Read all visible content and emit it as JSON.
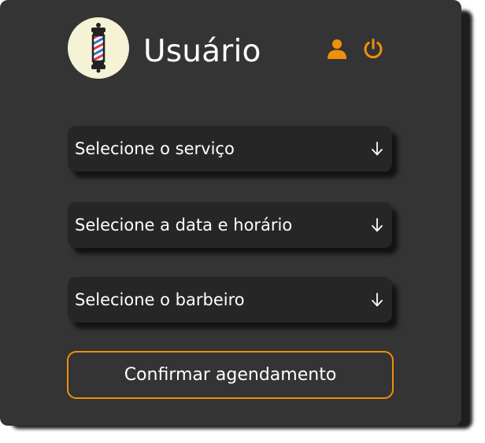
{
  "header": {
    "title": "Usuário",
    "logo_icon": "barber-pole-icon",
    "user_icon": "user-icon",
    "power_icon": "power-icon"
  },
  "selects": [
    {
      "label": "Selecione o serviço",
      "icon": "arrow-down-icon"
    },
    {
      "label": "Selecione a data e horário",
      "icon": "arrow-down-icon"
    },
    {
      "label": "Selecione o barbeiro",
      "icon": "arrow-down-icon"
    }
  ],
  "confirm_button": {
    "label": "Confirmar agendamento"
  },
  "colors": {
    "card_background": "#343434",
    "select_background": "#262626",
    "accent": "#f0900b",
    "logo_background": "#f6f2d6",
    "text": "#ffffff"
  }
}
